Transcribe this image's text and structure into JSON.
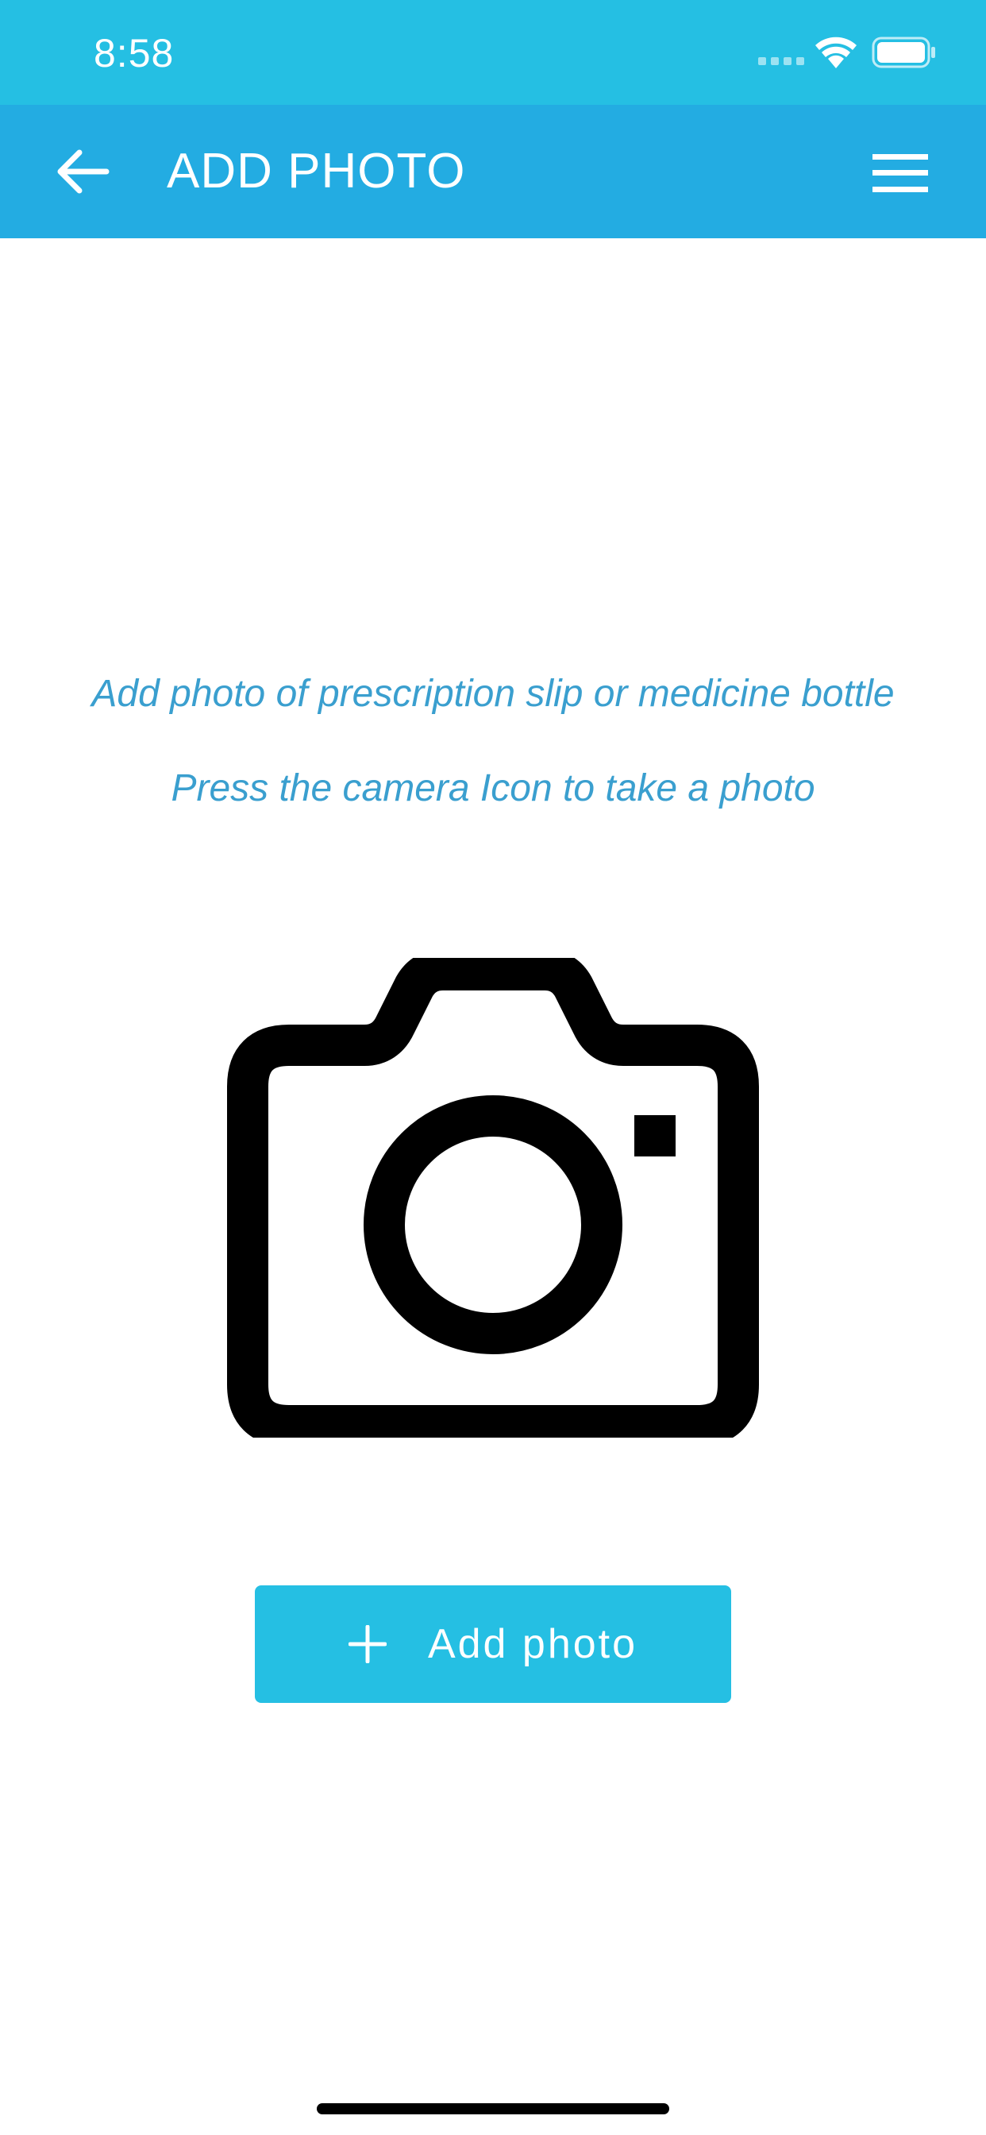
{
  "status_bar": {
    "time": "8:58",
    "signal_icon": "cellular-signal-icon",
    "wifi_icon": "wifi-icon",
    "battery_icon": "battery-icon",
    "background_color": "#25bfe3"
  },
  "app_bar": {
    "title": "ADD PHOTO",
    "back_icon": "arrow-left-icon",
    "menu_icon": "hamburger-menu-icon",
    "background_color": "#23ace2"
  },
  "main": {
    "instruction_primary": "Add photo of prescription slip or medicine bottle",
    "instruction_secondary": "Press the camera Icon to take a photo",
    "instruction_color": "#3a9fcf",
    "camera_icon": "camera-icon",
    "add_photo_button": {
      "label": "Add photo",
      "icon": "plus-icon",
      "background_color": "#25bfe3"
    }
  }
}
